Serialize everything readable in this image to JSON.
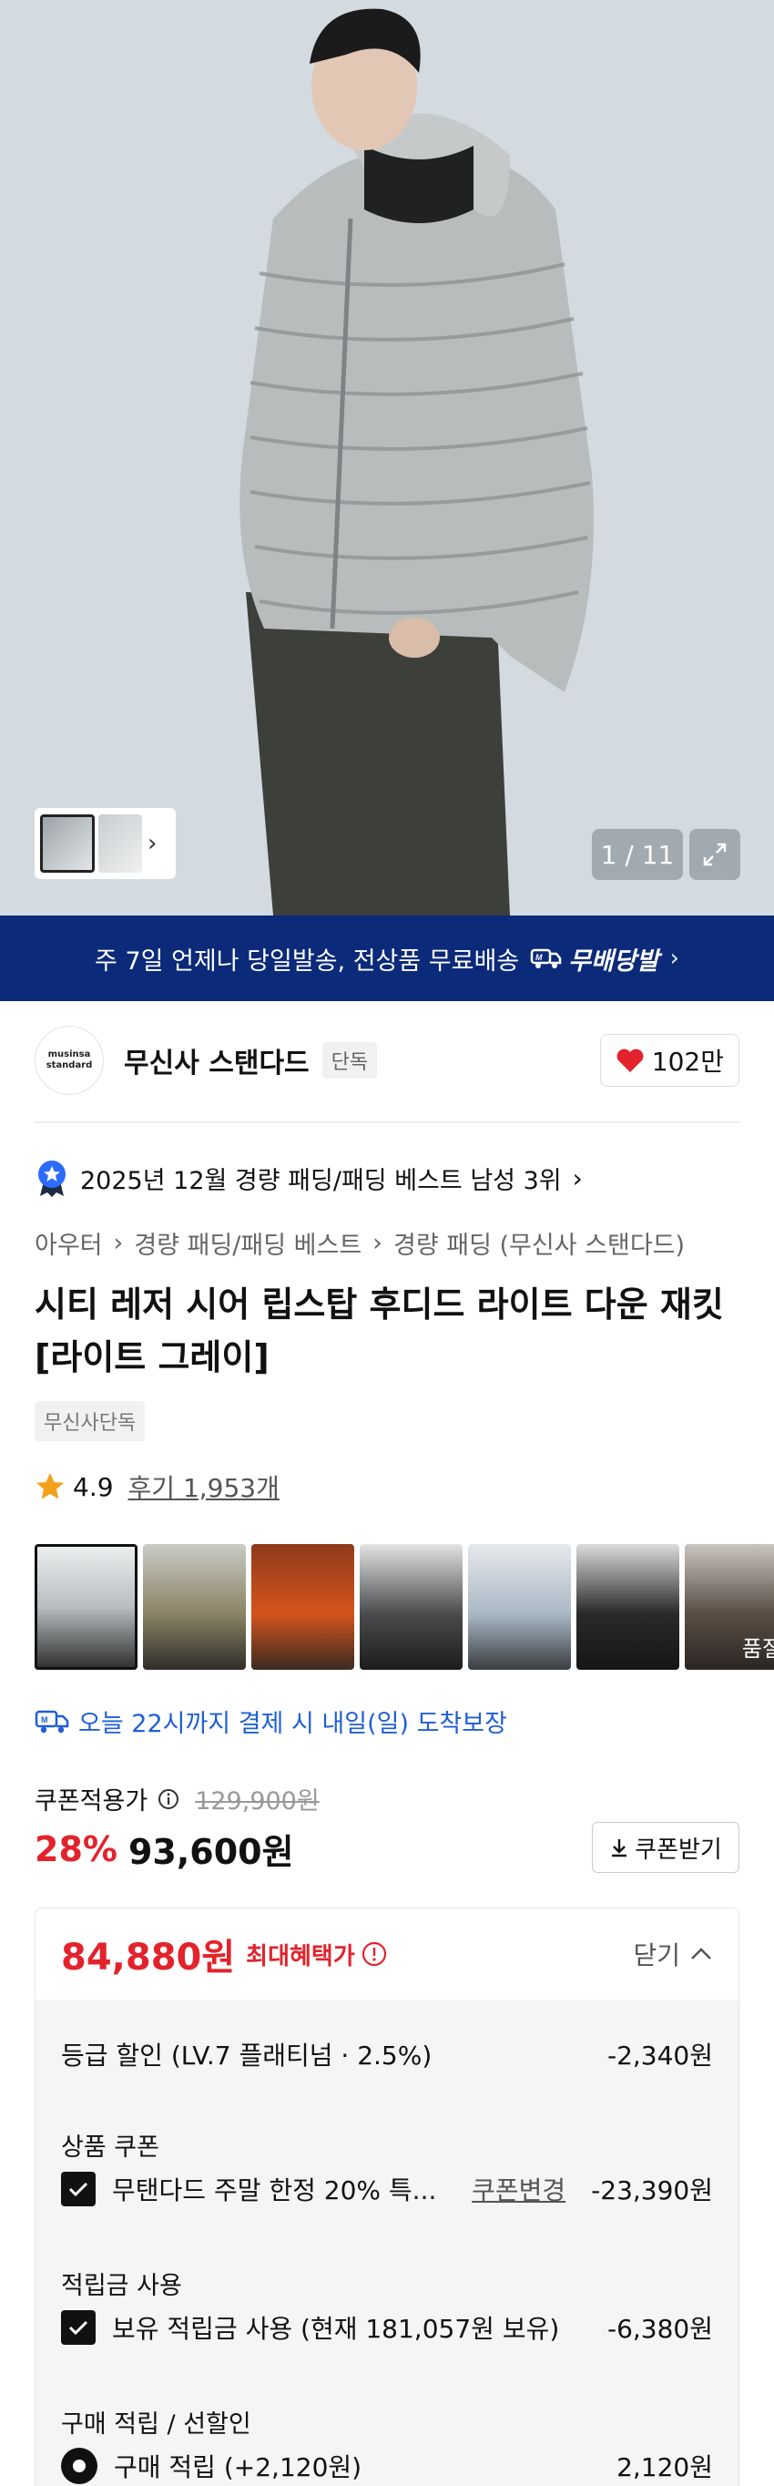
{
  "hero": {
    "counter": "1 / 11"
  },
  "banner": {
    "text": "주 7일 언제나 당일발송, 전상품 무료배송",
    "brand": "무배당발"
  },
  "brand": {
    "logo_line1": "musinsa",
    "logo_line2": "standard",
    "name": "무신사 스탠다드",
    "tag": "단독",
    "likes": "102만"
  },
  "best": {
    "text": "2025년 12월 경량 패딩/패딩 베스트 남성 3위"
  },
  "breadcrumb": {
    "c1": "아우터",
    "c2": "경량 패딩/패딩 베스트",
    "c3": "경량 패딩 (무신사 스탠다드)"
  },
  "product": {
    "title": "시티 레저 시어 립스탑 후디드 라이트 다운 재킷 [라이트 그레이]",
    "exclusive": "무신사단독",
    "rating": "4.9",
    "reviews": "후기 1,953개"
  },
  "colors": {
    "soldout_label": "품절"
  },
  "delivery": {
    "text": "오늘 22시까지 결제 시 내일(일) 도착보장"
  },
  "price": {
    "label": "쿠폰적용가",
    "original": "129,900원",
    "discount": "28%",
    "final": "93,600원",
    "coupon_button": "쿠폰받기"
  },
  "benefit": {
    "total": "84,880원",
    "max_label": "최대혜택가",
    "close_label": "닫기",
    "grade_label": "등급 할인 (LV.7 플래티넘 · 2.5%)",
    "grade_amount": "-2,340원",
    "coupon_title": "상품 쿠폰",
    "coupon_item": "무탠다드 주말 한정 20% 특...",
    "coupon_change": "쿠폰변경",
    "coupon_amount": "-23,390원",
    "points_title": "적립금 사용",
    "points_item": "보유 적립금 사용 (현재 181,057원 보유)",
    "points_amount": "-6,380원",
    "purchase_title": "구매 적립 / 선할인",
    "purchase_item": "구매 적립 (+2,120원)",
    "purchase_amount": "2,120원"
  },
  "accent": {
    "red": "#e3232c",
    "blue": "#1f5fd6",
    "navy": "#0c2a7a"
  }
}
